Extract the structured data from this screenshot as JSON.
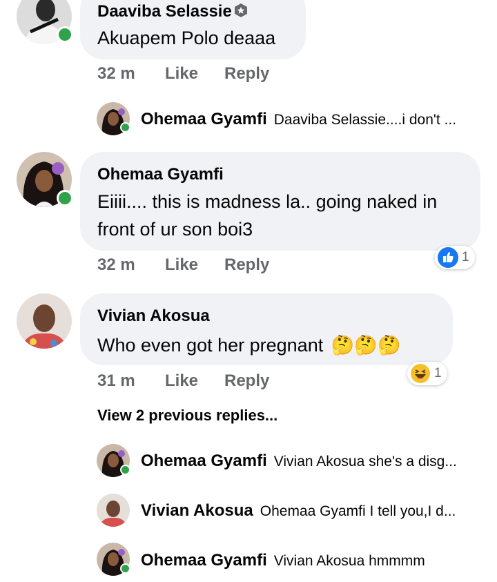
{
  "comments": [
    {
      "name": "Daaviba Selassie",
      "text": "Akuapem Polo deaaa",
      "time": "32 m",
      "like": "Like",
      "reply": "Reply"
    },
    {
      "name": "Ohemaa Gyamfi",
      "text_line1": "Eiiii.... this is madness la.. going naked in",
      "text_line2": "front of ur son boi3",
      "time": "32 m",
      "like": "Like",
      "reply": "Reply",
      "reaction_count": "1"
    },
    {
      "name": "Vivian Akosua",
      "text": "Who even got her pregnant",
      "emoji": "🤔🤔🤔",
      "time": "31 m",
      "like": "Like",
      "reply": "Reply",
      "reaction_count": "1"
    }
  ],
  "replies_first": {
    "name": "Ohemaa Gyamfi",
    "text": "Daaviba Selassie....i don't ..."
  },
  "view_previous": "View 2 previous replies...",
  "replies": [
    {
      "name": "Ohemaa Gyamfi",
      "text": "Vivian Akosua she's a disg..."
    },
    {
      "name": "Vivian Akosua",
      "text": "Ohemaa Gyamfi I tell you,I d..."
    },
    {
      "name": "Ohemaa Gyamfi",
      "text": "Vivian Akosua hmmmm"
    }
  ],
  "colors": {
    "online": "#31a24c",
    "bubble": "#f0f2f5",
    "meta": "#65676b",
    "like_blue": "#1877f2"
  },
  "icons": {
    "badge": "badge-icon",
    "like_reaction": "thumbs-up-icon",
    "haha_reaction": "laughing-face-icon"
  }
}
